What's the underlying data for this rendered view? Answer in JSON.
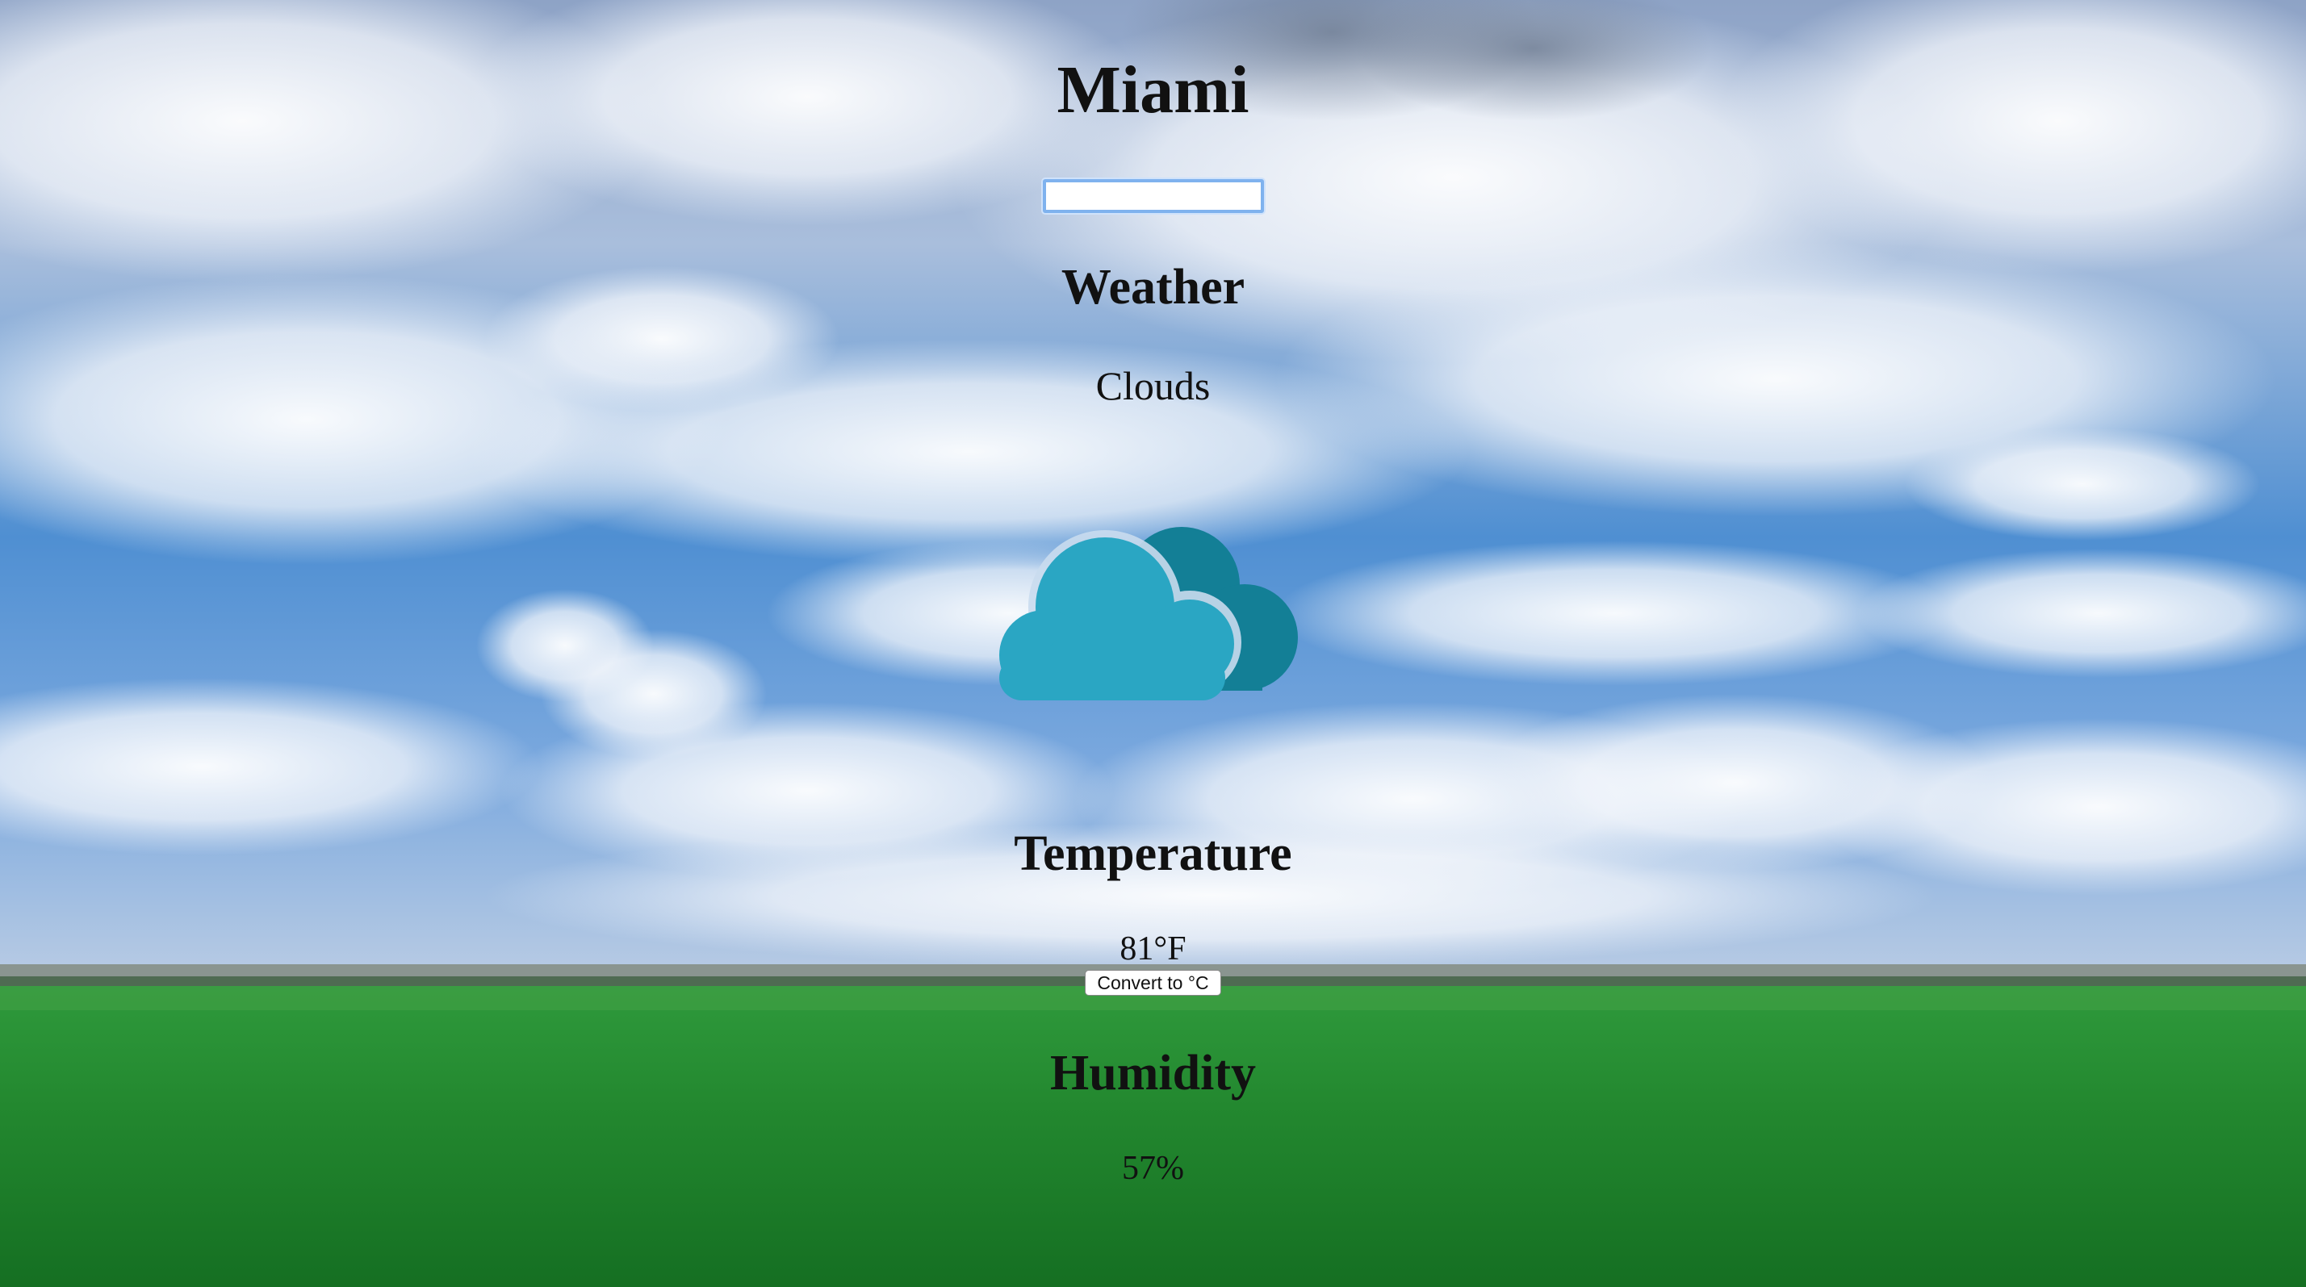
{
  "city": {
    "name": "Miami"
  },
  "search": {
    "value": "",
    "placeholder": ""
  },
  "weather": {
    "heading": "Weather",
    "condition": "Clouds",
    "icon": "cloud-icon"
  },
  "temperature": {
    "heading": "Temperature",
    "value": "81°F",
    "convert_label": "Convert to °C"
  },
  "humidity": {
    "heading": "Humidity",
    "value": "57%"
  },
  "colors": {
    "cloud_front": "#2aa6c3",
    "cloud_back": "#137f96",
    "sky_top": "#6f8fc0",
    "sky_mid": "#4b8ad0",
    "grass": "#1f8a35"
  }
}
